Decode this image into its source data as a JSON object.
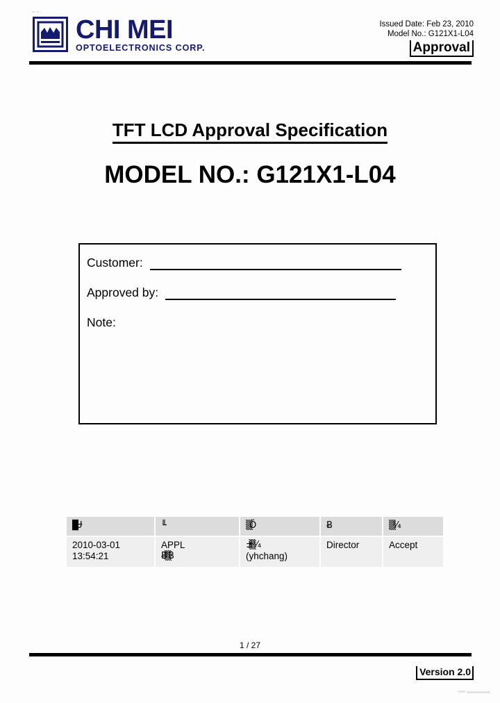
{
  "header": {
    "logo": {
      "mark": "chi-mei-square-logo",
      "name": "CHI MEI",
      "subtitle": "OPTOELECTRONICS CORP.",
      "color": "#151a6e"
    },
    "issued_date_line": "Issued Date: Feb 23, 2010",
    "model_no_line": "Model  No.:  G121X1-L04",
    "approval_label": "Approval"
  },
  "titles": {
    "doc_title": "TFT LCD Approval Specification",
    "model_heading": "MODEL NO.: G121X1-L04"
  },
  "customer_box": {
    "customer_label": "Customer:",
    "approved_by_label": "Approved by:",
    "note_label": "Note:"
  },
  "signature_table": {
    "headers": [
      "▉Ʉ",
      "╙",
      "▒Ö",
      "Ƀ",
      "▒¼"
    ],
    "rows": [
      {
        "cells": [
          {
            "lines": [
              "2010-03-01",
              "13:54:21"
            ]
          },
          {
            "lines": [
              "APPL",
              "Ƀº▒B"
            ]
          },
          {
            "lines": [
              "±i▒¼",
              "(yhchang)"
            ]
          },
          {
            "lines": [
              "Director"
            ]
          },
          {
            "lines": [
              "Accept"
            ]
          }
        ]
      }
    ]
  },
  "footer": {
    "page_number": "1 / 27",
    "version": "Version 2.0"
  }
}
